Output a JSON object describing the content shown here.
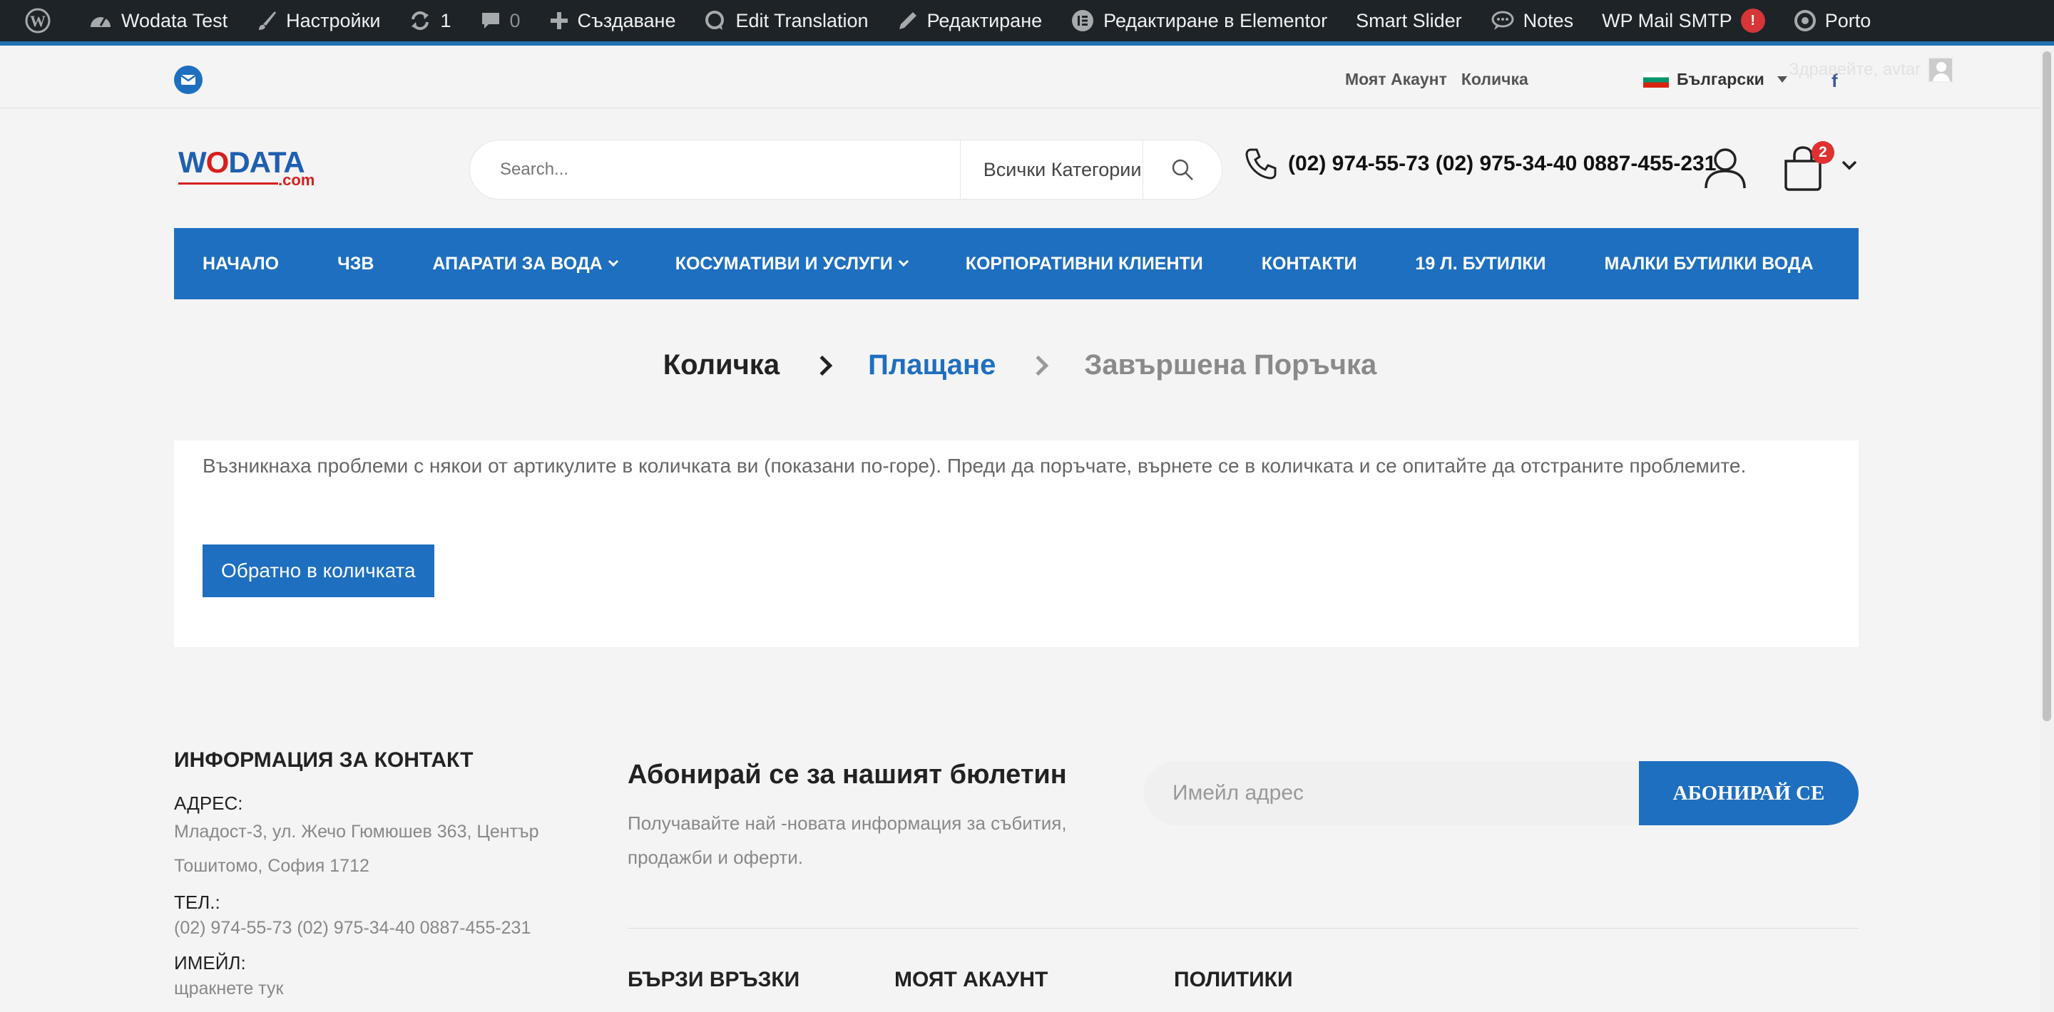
{
  "admin_bar": {
    "site_name": "Wodata Test",
    "customize": "Настройки",
    "updates_count": "1",
    "comments_count": "0",
    "new": "Създаване",
    "edit_translation": "Edit Translation",
    "edit": "Редактиране",
    "edit_elementor": "Редактиране в Elementor",
    "smart_slider": "Smart Slider",
    "notes": "Notes",
    "wp_mail_smtp": "WP Mail SMTP",
    "smtp_alert": "!",
    "porto": "Porto",
    "greeting": "Здравейте, avtar"
  },
  "topbar": {
    "my_account": "Моят Акаунт",
    "cart": "Количка",
    "language": "Български",
    "facebook": "f"
  },
  "header": {
    "logo_text_1": "W",
    "logo_text_o": "O",
    "logo_text_2": "DATA",
    "logo_suffix": ".com",
    "search_placeholder": "Search...",
    "category": "Всички Категории",
    "phones": "(02) 974-55-73 (02) 975-34-40 0887-455-231",
    "cart_count": "2"
  },
  "nav": [
    {
      "label": "НАЧАЛО",
      "dropdown": false
    },
    {
      "label": "ЧЗВ",
      "dropdown": false
    },
    {
      "label": "АПАРАТИ ЗА ВОДА",
      "dropdown": true
    },
    {
      "label": "КОСУМАТИВИ И УСЛУГИ",
      "dropdown": true
    },
    {
      "label": "КОРПОРАТИВНИ КЛИЕНТИ",
      "dropdown": false
    },
    {
      "label": "КОНТАКТИ",
      "dropdown": false
    },
    {
      "label": "19 Л. БУТИЛКИ",
      "dropdown": false
    },
    {
      "label": "МАЛКИ БУТИЛКИ ВОДА",
      "dropdown": false
    }
  ],
  "steps": {
    "cart": "Количка",
    "checkout": "Плащане",
    "complete": "Завършена Поръчка"
  },
  "notice": {
    "message": "Възникнаха проблеми с някои от артикулите в количката ви (показани по-горе). Преди да поръчате, върнете се в количката и се опитайте да отстраните проблемите.",
    "button": "Обратно в количката"
  },
  "footer": {
    "contact_title": "ИНФОРМАЦИЯ ЗА КОНТАКТ",
    "address_label": "АДРЕС:",
    "address_value": "Младост-3, ул. Жечо Гюмюшев 363, Център Тошитомо, София 1712",
    "phone_label": "ТЕЛ.:",
    "phone_value": "(02) 974-55-73 (02) 975-34-40 0887-455-231",
    "email_label": "ИМЕЙЛ:",
    "email_value": "щракнете тук",
    "newsletter_title": "Абонирай се за нашият бюлетин",
    "newsletter_desc": "Получавайте най -новата информация за събития, продажби и оферти.",
    "email_placeholder": "Имейл адрес",
    "subscribe": "АБОНИРАЙ СЕ",
    "quick_links": "БЪРЗИ ВРЪЗКИ",
    "my_account": "МОЯТ АКАУНТ",
    "policies": "ПОЛИТИКИ"
  },
  "colors": {
    "primary": "#1e6fbf",
    "admin_bar": "#1d2327",
    "alert": "#d63638"
  }
}
